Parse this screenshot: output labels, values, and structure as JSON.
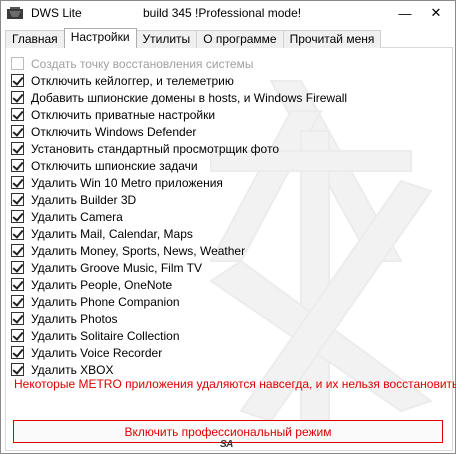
{
  "window": {
    "app_title": "DWS Lite",
    "build_title": "build 345  !Professional mode!",
    "minimize_glyph": "—",
    "close_glyph": "✕"
  },
  "tabs": [
    {
      "label": "Главная",
      "active": false
    },
    {
      "label": "Настройки",
      "active": true
    },
    {
      "label": "Утилиты",
      "active": false
    },
    {
      "label": "О программе",
      "active": false
    },
    {
      "label": "Прочитай меня",
      "active": false
    }
  ],
  "options": [
    {
      "label": "Создать точку восстановления системы",
      "checked": false,
      "disabled": true
    },
    {
      "label": "Отключить кейлоггер, и телеметрию",
      "checked": true,
      "disabled": false
    },
    {
      "label": "Добавить шпионские домены в hosts, и Windows Firewall",
      "checked": true,
      "disabled": false
    },
    {
      "label": "Отключить приватные настройки",
      "checked": true,
      "disabled": false
    },
    {
      "label": "Отключить Windows Defender",
      "checked": true,
      "disabled": false
    },
    {
      "label": "Установить стандартный просмотрщик фото",
      "checked": true,
      "disabled": false
    },
    {
      "label": "Отключить шпионские задачи",
      "checked": true,
      "disabled": false
    },
    {
      "label": "Удалить Win 10 Metro приложения",
      "checked": true,
      "disabled": false
    },
    {
      "label": "Удалить Builder 3D",
      "checked": true,
      "disabled": false
    },
    {
      "label": "Удалить Camera",
      "checked": true,
      "disabled": false
    },
    {
      "label": "Удалить Mail, Calendar, Maps",
      "checked": true,
      "disabled": false
    },
    {
      "label": "Удалить Money, Sports, News, Weather",
      "checked": true,
      "disabled": false
    },
    {
      "label": "Удалить Groove Music, Film TV",
      "checked": true,
      "disabled": false
    },
    {
      "label": "Удалить People, OneNote",
      "checked": true,
      "disabled": false
    },
    {
      "label": "Удалить Phone Companion",
      "checked": true,
      "disabled": false
    },
    {
      "label": "Удалить Photos",
      "checked": true,
      "disabled": false
    },
    {
      "label": "Удалить Solitaire Collection",
      "checked": true,
      "disabled": false
    },
    {
      "label": "Удалить Voice Recorder",
      "checked": true,
      "disabled": false
    },
    {
      "label": "Удалить XBOX",
      "checked": true,
      "disabled": false
    }
  ],
  "warning_text": "Некоторые METRO приложения удаляются навсегда, и их нельзя восстановить",
  "pro_button_label": "Включить профессиональный режим",
  "signature": "SA",
  "colors": {
    "warning": "#e00000",
    "disabled_text": "#a0a0a0"
  }
}
